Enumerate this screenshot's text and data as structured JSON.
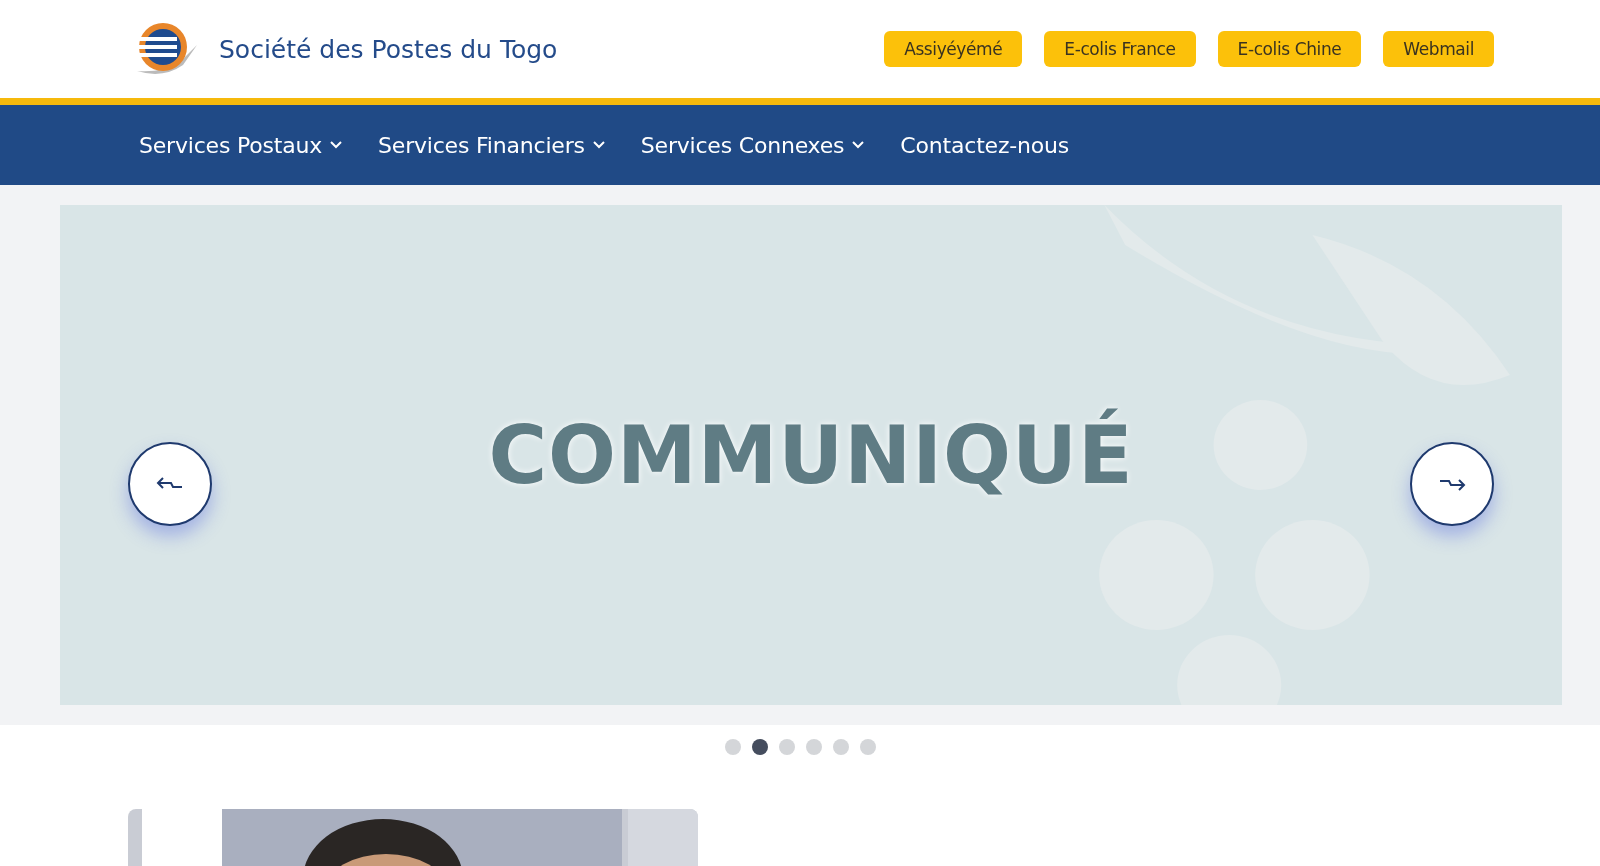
{
  "header": {
    "site_title": "Société des Postes du Togo",
    "quick_links": [
      {
        "label": "Assiyéyémé"
      },
      {
        "label": "E-colis France"
      },
      {
        "label": "E-colis Chine"
      },
      {
        "label": "Webmail"
      }
    ]
  },
  "nav": {
    "items": [
      {
        "label": "Services Postaux",
        "has_menu": true
      },
      {
        "label": "Services Financiers",
        "has_menu": true
      },
      {
        "label": "Services Connexes",
        "has_menu": true
      },
      {
        "label": "Contactez-nous",
        "has_menu": false
      }
    ]
  },
  "slider": {
    "slide": {
      "heading": "COMMUNIQUÉ"
    },
    "dots": [
      {
        "selected": false
      },
      {
        "selected": true
      },
      {
        "selected": false
      },
      {
        "selected": false
      },
      {
        "selected": false
      },
      {
        "selected": false
      }
    ]
  }
}
